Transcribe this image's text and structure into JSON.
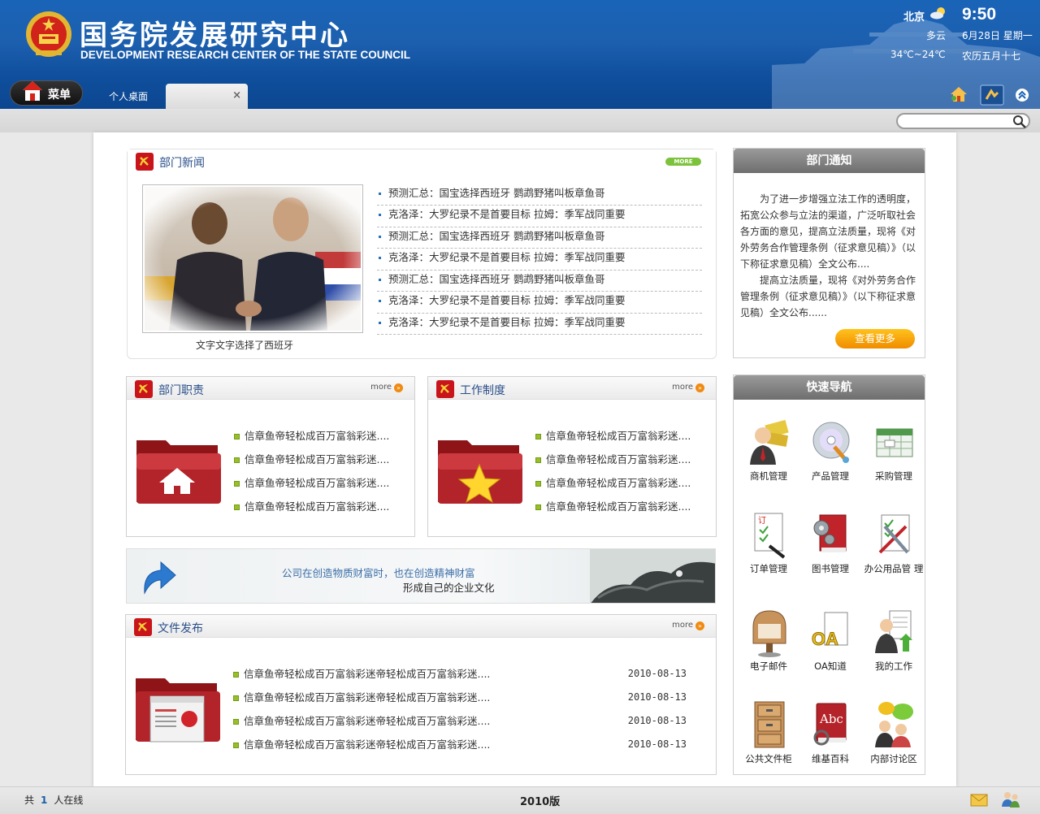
{
  "header": {
    "title_cn": "国务院发展研究中心",
    "title_en": "DEVELOPMENT RESEARCH CENTER OF THE STATE COUNCIL",
    "weather": {
      "city": "北京",
      "time": "9:50",
      "condition": "多云",
      "date": "6月28日 星期一",
      "temperature": "34℃~24℃",
      "lunar": "农历五月十七",
      "icon": "partly-cloudy-icon"
    }
  },
  "nav": {
    "menu_label": "菜单",
    "tabs": [
      {
        "label": "个人桌面"
      },
      {
        "label": ""
      }
    ],
    "close_glyph": "×",
    "search_placeholder": ""
  },
  "news": {
    "title": "部门新闻",
    "more_label": "MORE",
    "caption": "文字文字选择了西班牙",
    "items": [
      "预测汇总：国宝选择西班牙 鹦鹉野猪叫板章鱼哥",
      "克洛泽：大罗纪录不是首要目标 拉姆：季军战同重要",
      "预测汇总：国宝选择西班牙 鹦鹉野猪叫板章鱼哥",
      "克洛泽：大罗纪录不是首要目标 拉姆：季军战同重要",
      "预测汇总：国宝选择西班牙 鹦鹉野猪叫板章鱼哥",
      "克洛泽：大罗纪录不是首要目标 拉姆：季军战同重要",
      "克洛泽：大罗纪录不是首要目标 拉姆：季军战同重要"
    ]
  },
  "notice": {
    "title": "部门通知",
    "paragraphs": [
      "为了进一步增强立法工作的透明度，拓宽公众参与立法的渠道，广泛听取社会各方面的意见，提高立法质量，现将《对外劳务合作管理条例（征求意见稿）》（以下称征求意见稿）全文公布....",
      "提高立法质量，现将《对外劳务合作管理条例（征求意见稿）》（以下称征求意见稿）全文公布......"
    ],
    "more_button": "查看更多"
  },
  "duty": {
    "title": "部门职责",
    "more_label": "more",
    "items": [
      "信章鱼帝轻松成百万富翁彩迷....",
      "信章鱼帝轻松成百万富翁彩迷....",
      "信章鱼帝轻松成百万富翁彩迷....",
      "信章鱼帝轻松成百万富翁彩迷...."
    ]
  },
  "work": {
    "title": "工作制度",
    "more_label": "more",
    "items": [
      "信章鱼帝轻松成百万富翁彩迷....",
      "信章鱼帝轻松成百万富翁彩迷....",
      "信章鱼帝轻松成百万富翁彩迷....",
      "信章鱼帝轻松成百万富翁彩迷...."
    ]
  },
  "banner": {
    "line1": "公司在创造物质财富时，也在创造精神财富",
    "line2": "形成自己的企业文化"
  },
  "docs": {
    "title": "文件发布",
    "more_label": "more",
    "items": [
      {
        "text": "信章鱼帝轻松成百万富翁彩迷帝轻松成百万富翁彩迷....",
        "date": "2010-08-13"
      },
      {
        "text": "信章鱼帝轻松成百万富翁彩迷帝轻松成百万富翁彩迷....",
        "date": "2010-08-13"
      },
      {
        "text": "信章鱼帝轻松成百万富翁彩迷帝轻松成百万富翁彩迷....",
        "date": "2010-08-13"
      },
      {
        "text": "信章鱼帝轻松成百万富翁彩迷帝轻松成百万富翁彩迷....",
        "date": "2010-08-13"
      }
    ]
  },
  "quicknav": {
    "title": "快速导航",
    "items": [
      {
        "label": "商机管理",
        "icon": "business-opportunity-icon"
      },
      {
        "label": "产品管理",
        "icon": "product-disc-icon"
      },
      {
        "label": "采购管理",
        "icon": "purchase-table-icon"
      },
      {
        "label": "订单管理",
        "icon": "order-document-icon"
      },
      {
        "label": "图书管理",
        "icon": "book-gear-icon"
      },
      {
        "label": "办公用品管 理",
        "icon": "office-tools-icon"
      },
      {
        "label": "电子邮件",
        "icon": "mailbox-icon"
      },
      {
        "label": "OA知道",
        "icon": "oa-knowledge-icon"
      },
      {
        "label": "我的工作",
        "icon": "my-work-icon"
      },
      {
        "label": "公共文件柜",
        "icon": "file-cabinet-icon"
      },
      {
        "label": "维基百科",
        "icon": "wiki-book-icon"
      },
      {
        "label": "内部讨论区",
        "icon": "discussion-people-icon"
      }
    ]
  },
  "footer": {
    "online_prefix": "共",
    "online_count": "1",
    "online_suffix": "人在线",
    "version": "2010版"
  },
  "colors": {
    "header_blue": "#1c5fae",
    "accent_orange": "#f08c00",
    "party_red": "#c8141a",
    "title_blue": "#2a4f8a"
  }
}
